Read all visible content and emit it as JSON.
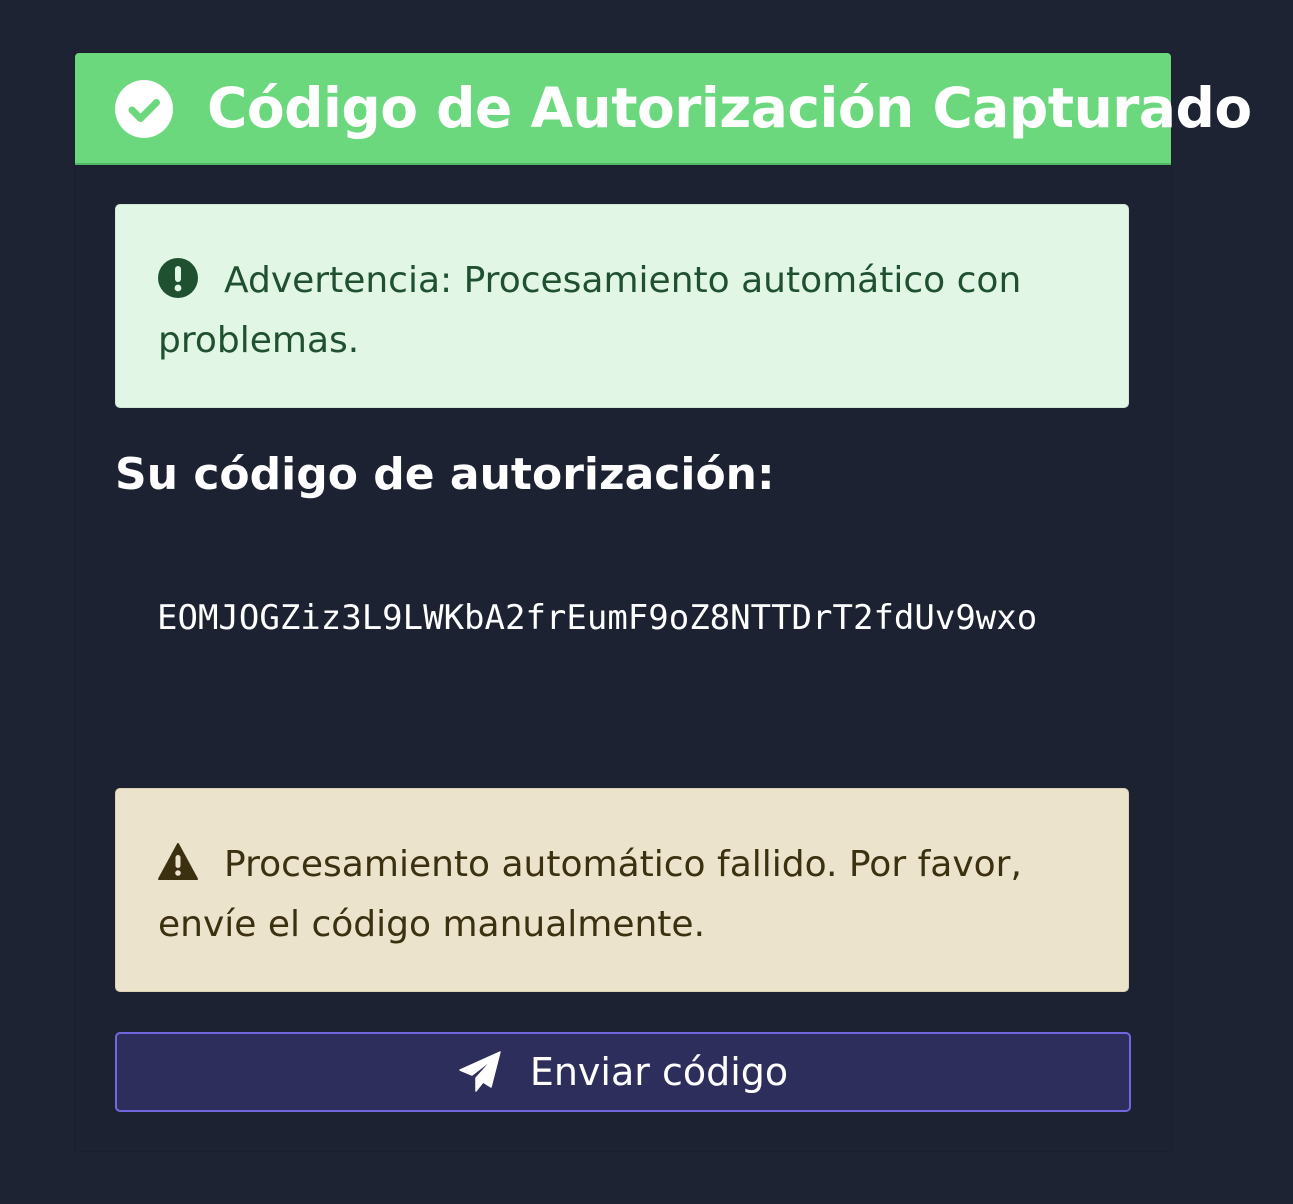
{
  "header": {
    "title": "Código de Autorización Capturado",
    "icon": "check-circle-icon",
    "color": "#6bd87e"
  },
  "success_alert": {
    "icon": "exclamation-circle-icon",
    "text": "Advertencia: Procesamiento automático con problemas."
  },
  "code_section": {
    "label": "Su código de autorización:",
    "code": "EOMJOGZiz3L9LWKbA2frEumF9oZ8NTTDrT2fdUv9wxo"
  },
  "warning_alert": {
    "icon": "warning-triangle-icon",
    "text": "Procesamiento automático fallido. Por favor, envíe el código manualmente."
  },
  "send_button": {
    "icon": "paper-plane-icon",
    "label": "Enviar código",
    "color": "#7367e0"
  }
}
